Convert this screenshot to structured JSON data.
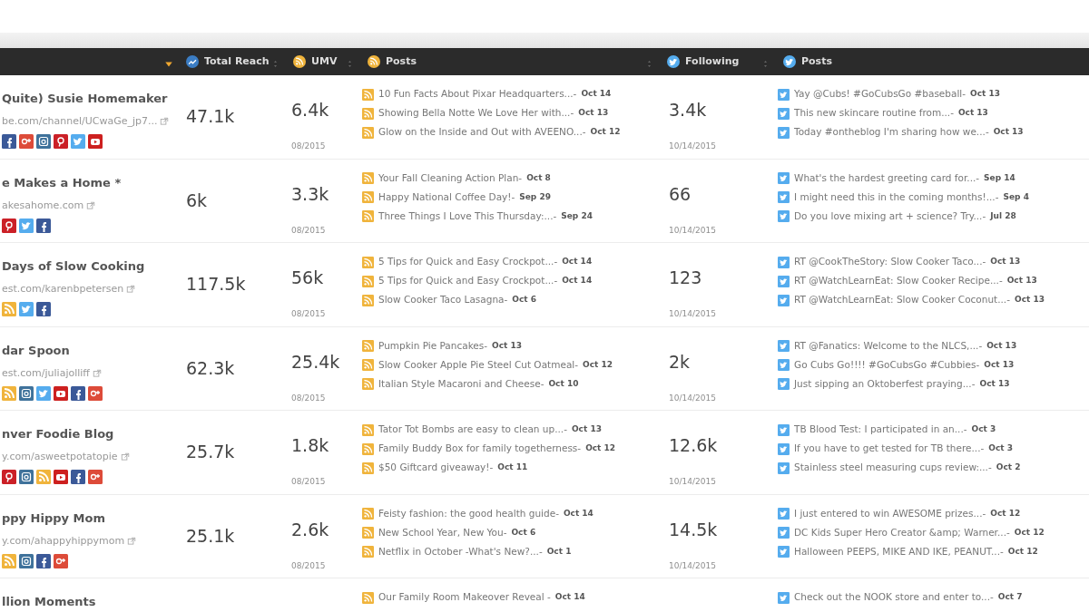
{
  "columns": [
    {
      "kind": "name",
      "sorted": true
    },
    {
      "kind": "reach",
      "label": "Total Reach",
      "sorted": false
    },
    {
      "kind": "umv",
      "label": "UMV",
      "sorted": false
    },
    {
      "kind": "posts",
      "label": "Posts",
      "sorted": false
    },
    {
      "kind": "following",
      "label": "Following",
      "sorted": false
    },
    {
      "kind": "tweets",
      "label": "Posts",
      "sorted": false
    }
  ],
  "rows": [
    {
      "name": "Quite) Susie Homemaker",
      "url": "be.com/channel/UCwaGe_jp7...",
      "socials": [
        {
          "kind": "facebook"
        },
        {
          "kind": "gplus"
        },
        {
          "kind": "instagram"
        },
        {
          "kind": "pinterest"
        },
        {
          "kind": "twitter"
        },
        {
          "kind": "youtube"
        }
      ],
      "total_reach": "47.1k",
      "umv": "6.4k",
      "umv_date": "08/2015",
      "following": "3.4k",
      "following_date": "10/14/2015",
      "posts": [
        {
          "title": "10 Fun Facts About Pixar Headquarters...-",
          "date": "Oct 14"
        },
        {
          "title": "Showing Bella Notte We Love Her with...-",
          "date": "Oct 13"
        },
        {
          "title": "Glow on the Inside and Out with AVEENO...-",
          "date": "Oct 12"
        }
      ],
      "tweets": [
        {
          "text": "Yay @Cubs! #GoCubsGo #baseball-",
          "date": "Oct 13"
        },
        {
          "text": "This new skincare routine from...-",
          "date": "Oct 13"
        },
        {
          "text": "Today #ontheblog I'm sharing how we...-",
          "date": "Oct 13"
        }
      ]
    },
    {
      "name": "e Makes a Home *",
      "url": "akesahome.com",
      "socials": [
        {
          "kind": "pinterest"
        },
        {
          "kind": "twitter"
        },
        {
          "kind": "facebook"
        }
      ],
      "total_reach": "6k",
      "umv": "3.3k",
      "umv_date": "08/2015",
      "following": "66",
      "following_date": "10/14/2015",
      "posts": [
        {
          "title": "Your Fall Cleaning Action Plan-",
          "date": "Oct 8"
        },
        {
          "title": "Happy National Coffee Day!-",
          "date": "Sep 29"
        },
        {
          "title": "Three Things I Love This Thursday:...-",
          "date": "Sep 24"
        }
      ],
      "tweets": [
        {
          "text": "What's the hardest greeting card for...-",
          "date": "Sep 14"
        },
        {
          "text": "I might need this in the coming months!...-",
          "date": "Sep 4"
        },
        {
          "text": "Do you love mixing art + science? Try...-",
          "date": "Jul 28"
        }
      ]
    },
    {
      "name": "Days of Slow Cooking",
      "url": "est.com/karenbpetersen",
      "socials": [
        {
          "kind": "rss"
        },
        {
          "kind": "twitter"
        },
        {
          "kind": "facebook"
        }
      ],
      "total_reach": "117.5k",
      "umv": "56k",
      "umv_date": "08/2015",
      "following": "123",
      "following_date": "10/14/2015",
      "posts": [
        {
          "title": "5 Tips for Quick and Easy Crockpot...-",
          "date": "Oct 14"
        },
        {
          "title": "5 Tips for Quick and Easy Crockpot...-",
          "date": "Oct 14"
        },
        {
          "title": "Slow Cooker Taco Lasagna-",
          "date": "Oct 6"
        }
      ],
      "tweets": [
        {
          "text": "RT @CookTheStory: Slow Cooker Taco...-",
          "date": "Oct 13"
        },
        {
          "text": "RT @WatchLearnEat: Slow Cooker Recipe...-",
          "date": "Oct 13"
        },
        {
          "text": "RT @WatchLearnEat: Slow Cooker Coconut...-",
          "date": "Oct 13"
        }
      ]
    },
    {
      "name": "dar Spoon",
      "url": "est.com/juliajolliff",
      "socials": [
        {
          "kind": "rss"
        },
        {
          "kind": "instagram"
        },
        {
          "kind": "twitter"
        },
        {
          "kind": "youtube"
        },
        {
          "kind": "facebook"
        },
        {
          "kind": "gplus"
        }
      ],
      "total_reach": "62.3k",
      "umv": "25.4k",
      "umv_date": "08/2015",
      "following": "2k",
      "following_date": "10/14/2015",
      "posts": [
        {
          "title": "Pumpkin Pie Pancakes-",
          "date": "Oct 13"
        },
        {
          "title": "Slow Cooker Apple Pie Steel Cut Oatmeal-",
          "date": "Oct 12"
        },
        {
          "title": "Italian Style Macaroni and Cheese-",
          "date": "Oct 10"
        }
      ],
      "tweets": [
        {
          "text": "RT @Fanatics: Welcome to the NLCS,...-",
          "date": "Oct 13"
        },
        {
          "text": "Go Cubs Go!!!! #GoCubsGo #Cubbies-",
          "date": "Oct 13"
        },
        {
          "text": "Just sipping an Oktoberfest praying...-",
          "date": "Oct 13"
        }
      ]
    },
    {
      "name": "nver Foodie Blog",
      "url": "y.com/asweetpotatopie",
      "socials": [
        {
          "kind": "pinterest"
        },
        {
          "kind": "instagram"
        },
        {
          "kind": "rss"
        },
        {
          "kind": "youtube"
        },
        {
          "kind": "facebook"
        },
        {
          "kind": "gplus"
        }
      ],
      "total_reach": "25.7k",
      "umv": "1.8k",
      "umv_date": "08/2015",
      "following": "12.6k",
      "following_date": "10/14/2015",
      "posts": [
        {
          "title": "Tator Tot Bombs are easy to clean up...-",
          "date": "Oct 13"
        },
        {
          "title": "Family Buddy Box for family togetherness-",
          "date": "Oct 12"
        },
        {
          "title": "$50 Giftcard giveaway!-",
          "date": "Oct 11"
        }
      ],
      "tweets": [
        {
          "text": "TB Blood Test: I participated in an...-",
          "date": "Oct 3"
        },
        {
          "text": "If you have to get tested for TB there...-",
          "date": "Oct 3"
        },
        {
          "text": "Stainless steel measuring cups review:...-",
          "date": "Oct 2"
        }
      ]
    },
    {
      "name": "ppy Hippy Mom",
      "url": "y.com/ahappyhippymom",
      "socials": [
        {
          "kind": "rss"
        },
        {
          "kind": "instagram"
        },
        {
          "kind": "facebook"
        },
        {
          "kind": "gplus"
        }
      ],
      "total_reach": "25.1k",
      "umv": "2.6k",
      "umv_date": "08/2015",
      "following": "14.5k",
      "following_date": "10/14/2015",
      "posts": [
        {
          "title": "Feisty fashion: the good health guide-",
          "date": "Oct 14"
        },
        {
          "title": "New School Year, New You-",
          "date": "Oct 6"
        },
        {
          "title": "Netflix in October -What's New?...-",
          "date": "Oct 1"
        }
      ],
      "tweets": [
        {
          "text": "I just entered to win AWESOME prizes...-",
          "date": "Oct 12"
        },
        {
          "text": "DC Kids Super Hero Creator &amp; Warner...-",
          "date": "Oct 12"
        },
        {
          "text": "Halloween PEEPS, MIKE AND IKE, PEANUT...-",
          "date": "Oct 12"
        }
      ]
    },
    {
      "name": "llion Moments",
      "posts": [
        {
          "title": "Our Family Room Makeover Reveal -",
          "date": "Oct 14"
        }
      ],
      "tweets": [
        {
          "text": "Check out the NOOK store and enter to...-",
          "date": "Oct 7"
        }
      ]
    }
  ]
}
